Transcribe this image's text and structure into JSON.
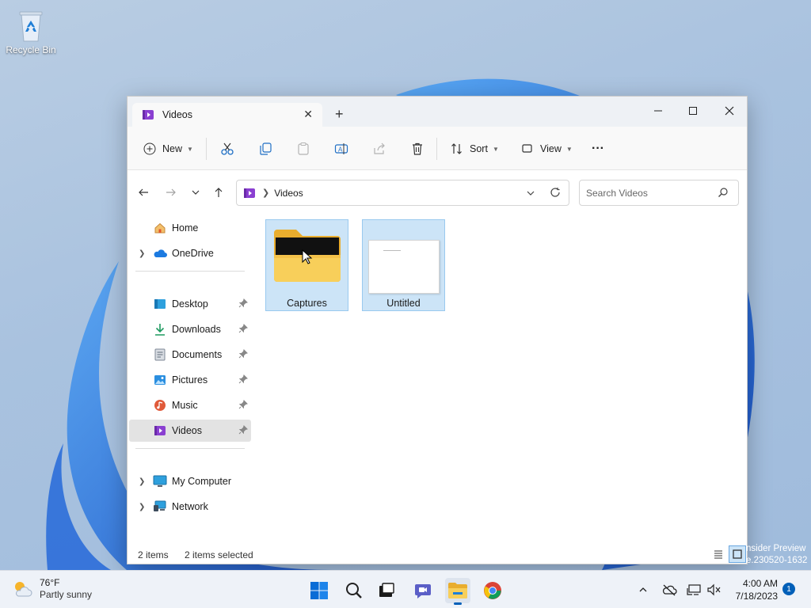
{
  "desktop": {
    "recycle_bin_label": "Recycle Bin",
    "watermark_line1": "nsider Preview",
    "watermark_line2": "e.230520-1632"
  },
  "window": {
    "tab_title": "Videos",
    "new_tab_label": "+",
    "toolbar": {
      "new_label": "New",
      "sort_label": "Sort",
      "view_label": "View",
      "more_label": "···"
    },
    "address": {
      "crumb": "Videos"
    },
    "search": {
      "placeholder": "Search Videos"
    },
    "sidebar": {
      "items": [
        {
          "label": "Home"
        },
        {
          "label": "OneDrive"
        },
        {
          "label": "Desktop"
        },
        {
          "label": "Downloads"
        },
        {
          "label": "Documents"
        },
        {
          "label": "Pictures"
        },
        {
          "label": "Music"
        },
        {
          "label": "Videos"
        },
        {
          "label": "My Computer"
        },
        {
          "label": "Network"
        }
      ]
    },
    "files": [
      {
        "name": "Captures",
        "type": "folder"
      },
      {
        "name": "Untitled",
        "type": "video"
      }
    ],
    "status": {
      "count": "2 items",
      "selected": "2 items selected"
    }
  },
  "taskbar": {
    "weather_temp": "76°F",
    "weather_desc": "Partly sunny",
    "time": "4:00 AM",
    "date": "7/18/2023",
    "notification_count": "1"
  },
  "colors": {
    "accent": "#005fb8",
    "selection": "#cce4f7",
    "folder": "#f5c242",
    "videos_icon": "#8a3fd1"
  }
}
